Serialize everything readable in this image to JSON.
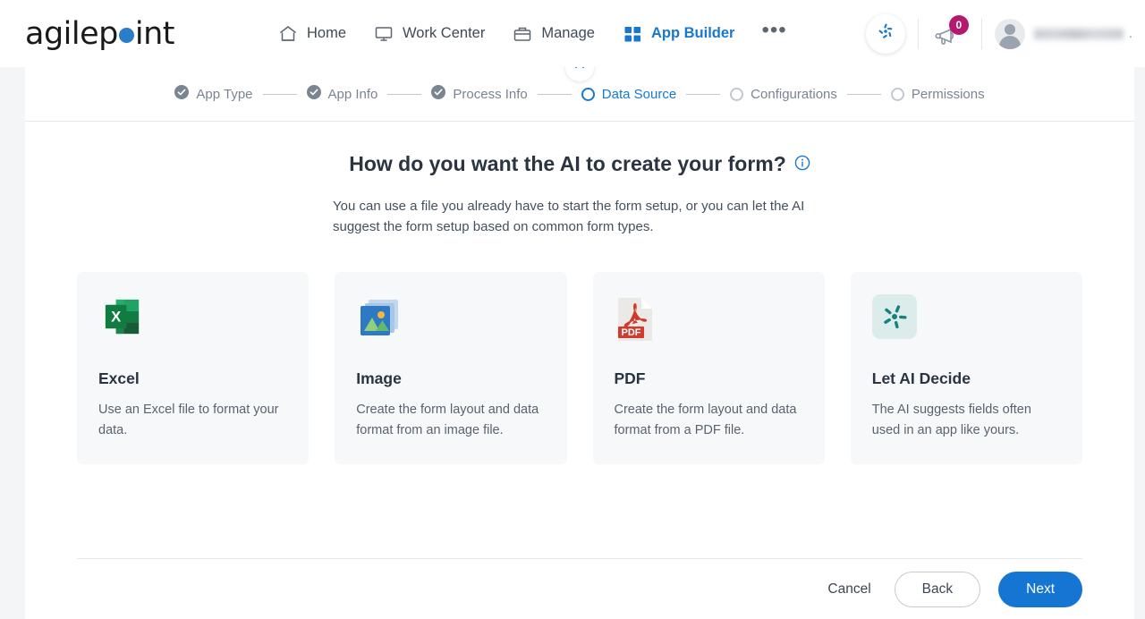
{
  "header": {
    "logo": {
      "before": "agilep",
      "dot": "o",
      "after": "int",
      "name": "agilepoint"
    },
    "nav": [
      {
        "label": "Home",
        "icon": "home-icon",
        "active": false
      },
      {
        "label": "Work Center",
        "icon": "monitor-icon",
        "active": false
      },
      {
        "label": "Manage",
        "icon": "briefcase-icon",
        "active": false
      },
      {
        "label": "App Builder",
        "icon": "grid-icon",
        "active": true
      }
    ],
    "more_label": "•••",
    "ai_assist_icon": "ai-pinwheel-icon",
    "announcements": {
      "icon": "megaphone-icon",
      "badge": "0"
    },
    "user": {
      "avatar": "user-avatar-icon",
      "name_masked": "",
      "trailing": "."
    }
  },
  "collapse_toggle": {
    "icon": "chevron-up-icon"
  },
  "stepper": {
    "steps": [
      {
        "label": "App Type",
        "state": "complete"
      },
      {
        "label": "App Info",
        "state": "complete"
      },
      {
        "label": "Process Info",
        "state": "complete"
      },
      {
        "label": "Data Source",
        "state": "current"
      },
      {
        "label": "Configurations",
        "state": "upcoming"
      },
      {
        "label": "Permissions",
        "state": "upcoming"
      }
    ]
  },
  "main": {
    "title": "How do you want the AI to create your form?",
    "info_icon": "info-circle-icon",
    "description": "You can use a file you already have to start the form setup, or you can let the AI suggest the form setup based on common form types.",
    "options": [
      {
        "icon": "excel-file-icon",
        "title": "Excel",
        "description": "Use an Excel file to format your data."
      },
      {
        "icon": "image-file-icon",
        "title": "Image",
        "description": "Create the form layout and data format from an image file."
      },
      {
        "icon": "pdf-file-icon",
        "title": "PDF",
        "description": "Create the form layout and data format from a PDF file."
      },
      {
        "icon": "ai-pinwheel-icon",
        "title": "Let AI Decide",
        "description": "The AI suggests fields often used in an app like yours."
      }
    ]
  },
  "footer": {
    "cancel_label": "Cancel",
    "back_label": "Back",
    "next_label": "Next"
  },
  "colors": {
    "accent_blue": "#1878d0",
    "primary_button": "#1476d2",
    "badge_magenta": "#b4186f",
    "card_bg": "#f7f8fa",
    "excel_green": "#1d6f42",
    "pdf_red": "#d23a2d",
    "ai_teal": "#17807e",
    "text_dark": "#2b3441",
    "text_muted": "#7a8591"
  }
}
